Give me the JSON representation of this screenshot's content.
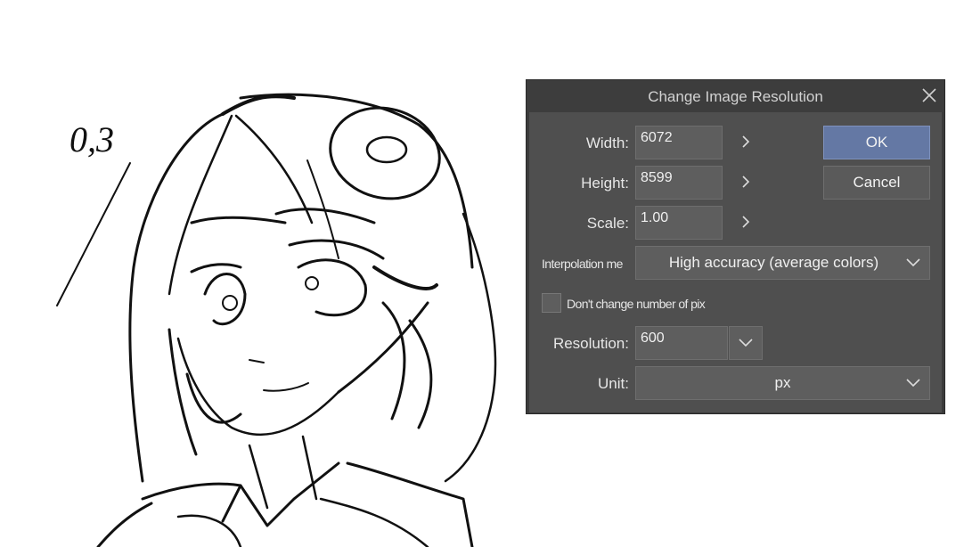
{
  "canvas": {
    "handwritten_note": "0,3"
  },
  "dialog": {
    "title": "Change Image Resolution",
    "width_label": "Width:",
    "width_value": "6072",
    "height_label": "Height:",
    "height_value": "8599",
    "scale_label": "Scale:",
    "scale_value": "1.00",
    "interpolation_label": "Interpolation me",
    "interpolation_value": "High accuracy (average colors)",
    "pixels_checkbox_label": "Don't change number of pix",
    "pixels_checkbox_checked": false,
    "resolution_label": "Resolution:",
    "resolution_value": "600",
    "unit_label": "Unit:",
    "unit_value": "px",
    "ok_label": "OK",
    "cancel_label": "Cancel"
  },
  "icons": {
    "close": "close-icon",
    "arrow": "chevron-right-icon",
    "dropdown": "chevron-down-icon"
  },
  "colors": {
    "ok_button": "#6478a4",
    "panel": "#4f4f4f",
    "titlebar": "#3d3d3d",
    "field": "#5e5e5e"
  }
}
